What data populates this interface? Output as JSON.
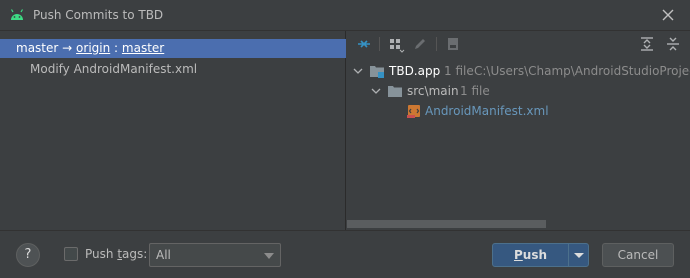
{
  "window": {
    "title": "Push Commits to TBD",
    "close_icon": "close-icon",
    "app_icon": "android-icon"
  },
  "left": {
    "branch": {
      "local": "master",
      "arrow": "→",
      "remote": "origin",
      "separator": ":",
      "target": "master"
    },
    "commits": [
      "Modify AndroidManifest.xml"
    ]
  },
  "toolbar": {
    "icons": [
      "expand-collapse-icon",
      "group-by-icon",
      "edit-icon",
      "save-icon",
      "expand-all-icon",
      "collapse-all-icon"
    ]
  },
  "tree": {
    "root": {
      "name": "TBD.app",
      "count": "1 file",
      "path": "C:\\Users\\Champ\\AndroidStudioProjects\\A"
    },
    "folder": {
      "name": "src\\main",
      "count": "1 file"
    },
    "file": {
      "name": "AndroidManifest.xml"
    }
  },
  "footer": {
    "help": "?",
    "push_tags_label_pre": "Push ",
    "push_tags_label_mnemonic": "t",
    "push_tags_label_post": "ags:",
    "push_tags_checked": false,
    "tags_selected": "All",
    "push_label_mnemonic": "P",
    "push_label_rest": "ush",
    "cancel_label": "Cancel"
  },
  "colors": {
    "background": "#3c3f41",
    "selection": "#4b6eaf",
    "primary_button": "#365880",
    "link": "#6897bb",
    "android_green": "#3ddc84"
  }
}
